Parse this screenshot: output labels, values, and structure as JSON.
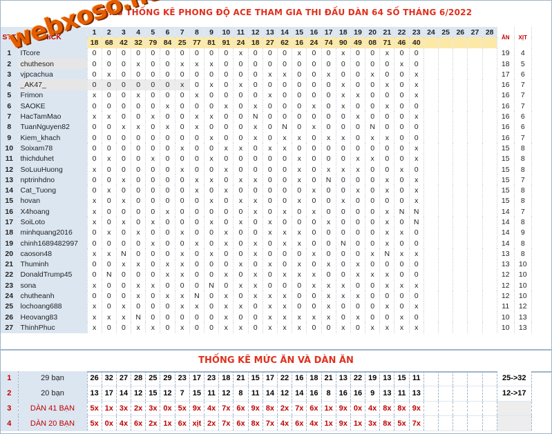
{
  "title": "BẢNG THỐNG KÊ PHONG ĐỘ ACE THAM GIA THI ĐẤU DÀN 64 SỐ THÁNG 6/2022",
  "watermark": "webxoso.net",
  "header": {
    "stt": "STT",
    "nick": "NICK",
    "days": [
      "1",
      "2",
      "3",
      "4",
      "5",
      "6",
      "7",
      "8",
      "9",
      "10",
      "11",
      "12",
      "13",
      "14",
      "15",
      "16",
      "17",
      "18",
      "19",
      "20",
      "21",
      "22",
      "23",
      "24",
      "25",
      "26",
      "27",
      "28"
    ],
    "results": [
      "18",
      "68",
      "42",
      "32",
      "79",
      "84",
      "25",
      "77",
      "81",
      "91",
      "24",
      "18",
      "27",
      "62",
      "16",
      "24",
      "74",
      "90",
      "49",
      "08",
      "71",
      "46",
      "40",
      "",
      "",
      "",
      "",
      ""
    ],
    "an": "ĂN",
    "xit": "XỊT"
  },
  "rows": [
    {
      "stt": "1",
      "nick": "ITcore",
      "marks": [
        "0",
        "0",
        "0",
        "0",
        "0",
        "0",
        "0",
        "0",
        "0",
        "0",
        "x",
        "0",
        "0",
        "0",
        "x",
        "0",
        "0",
        "x",
        "0",
        "0",
        "x",
        "0",
        "0"
      ],
      "an": "19",
      "xit": "4"
    },
    {
      "stt": "2",
      "nick": "chutheson",
      "marks": [
        "0",
        "0",
        "0",
        "x",
        "0",
        "0",
        "x",
        "x",
        "x",
        "0",
        "0",
        "0",
        "0",
        "0",
        "0",
        "0",
        "0",
        "0",
        "0",
        "0",
        "0",
        "x",
        "0"
      ],
      "an": "18",
      "xit": "5"
    },
    {
      "stt": "3",
      "nick": "vjpcachua",
      "marks": [
        "0",
        "x",
        "0",
        "0",
        "0",
        "0",
        "0",
        "0",
        "0",
        "0",
        "0",
        "0",
        "x",
        "x",
        "0",
        "0",
        "x",
        "0",
        "0",
        "x",
        "0",
        "0",
        "x"
      ],
      "an": "17",
      "xit": "6"
    },
    {
      "stt": "4",
      "nick": "_AK47_",
      "marks": [
        "0",
        "0",
        "0",
        "0",
        "0",
        "0",
        "x",
        "0",
        "x",
        "0",
        "x",
        "0",
        "0",
        "0",
        "0",
        "0",
        "0",
        "x",
        "0",
        "0",
        "x",
        "0",
        "x"
      ],
      "an": "16",
      "xit": "7"
    },
    {
      "stt": "5",
      "nick": "Frimon",
      "marks": [
        "x",
        "0",
        "0",
        "x",
        "0",
        "0",
        "0",
        "x",
        "0",
        "0",
        "0",
        "0",
        "x",
        "0",
        "0",
        "0",
        "0",
        "x",
        "x",
        "0",
        "0",
        "0",
        "x"
      ],
      "an": "16",
      "xit": "7"
    },
    {
      "stt": "6",
      "nick": "SAOKE",
      "marks": [
        "0",
        "0",
        "0",
        "0",
        "0",
        "x",
        "0",
        "0",
        "0",
        "x",
        "0",
        "x",
        "0",
        "0",
        "0",
        "x",
        "0",
        "x",
        "0",
        "0",
        "x",
        "0",
        "0"
      ],
      "an": "16",
      "xit": "7"
    },
    {
      "stt": "7",
      "nick": "HacTamMao",
      "marks": [
        "x",
        "x",
        "0",
        "0",
        "x",
        "0",
        "0",
        "x",
        "x",
        "0",
        "0",
        "N",
        "0",
        "0",
        "0",
        "0",
        "0",
        "0",
        "x",
        "0",
        "0",
        "0",
        "x"
      ],
      "an": "16",
      "xit": "6"
    },
    {
      "stt": "8",
      "nick": "TuanNguyen82",
      "marks": [
        "0",
        "0",
        "x",
        "x",
        "0",
        "x",
        "0",
        "x",
        "0",
        "0",
        "0",
        "x",
        "0",
        "N",
        "0",
        "x",
        "0",
        "0",
        "0",
        "N",
        "0",
        "0",
        "0"
      ],
      "an": "16",
      "xit": "6"
    },
    {
      "stt": "9",
      "nick": "Kiem_khach",
      "marks": [
        "0",
        "0",
        "0",
        "0",
        "0",
        "0",
        "0",
        "0",
        "x",
        "0",
        "0",
        "x",
        "0",
        "x",
        "x",
        "0",
        "x",
        "x",
        "0",
        "x",
        "x",
        "0",
        "0"
      ],
      "an": "16",
      "xit": "7"
    },
    {
      "stt": "10",
      "nick": "Soixam78",
      "marks": [
        "0",
        "0",
        "0",
        "0",
        "0",
        "0",
        "x",
        "0",
        "0",
        "x",
        "x",
        "0",
        "x",
        "x",
        "0",
        "0",
        "0",
        "0",
        "0",
        "0",
        "0",
        "0",
        "x"
      ],
      "an": "15",
      "xit": "8"
    },
    {
      "stt": "11",
      "nick": "thichduhet",
      "marks": [
        "0",
        "x",
        "0",
        "0",
        "x",
        "0",
        "0",
        "0",
        "x",
        "0",
        "0",
        "0",
        "0",
        "0",
        "x",
        "0",
        "0",
        "0",
        "x",
        "x",
        "0",
        "0",
        "x"
      ],
      "an": "15",
      "xit": "8"
    },
    {
      "stt": "12",
      "nick": "SoLuuHuong",
      "marks": [
        "x",
        "0",
        "0",
        "0",
        "0",
        "0",
        "x",
        "0",
        "0",
        "x",
        "0",
        "0",
        "0",
        "0",
        "x",
        "0",
        "x",
        "x",
        "x",
        "0",
        "0",
        "x",
        "0"
      ],
      "an": "15",
      "xit": "8"
    },
    {
      "stt": "13",
      "nick": "nptrinhdno",
      "marks": [
        "0",
        "0",
        "x",
        "0",
        "0",
        "0",
        "0",
        "x",
        "x",
        "0",
        "x",
        "x",
        "0",
        "0",
        "x",
        "0",
        "N",
        "0",
        "0",
        "0",
        "x",
        "0",
        "x"
      ],
      "an": "15",
      "xit": "7"
    },
    {
      "stt": "14",
      "nick": "Cat_Tuong",
      "marks": [
        "0",
        "x",
        "0",
        "0",
        "0",
        "0",
        "0",
        "x",
        "0",
        "x",
        "0",
        "0",
        "0",
        "0",
        "0",
        "x",
        "0",
        "0",
        "x",
        "0",
        "x",
        "0",
        "x"
      ],
      "an": "15",
      "xit": "8"
    },
    {
      "stt": "15",
      "nick": "hovan",
      "marks": [
        "x",
        "0",
        "x",
        "0",
        "0",
        "0",
        "0",
        "0",
        "x",
        "0",
        "x",
        "x",
        "0",
        "0",
        "x",
        "0",
        "0",
        "x",
        "0",
        "0",
        "0",
        "0",
        "x"
      ],
      "an": "15",
      "xit": "8"
    },
    {
      "stt": "16",
      "nick": "X4hoang",
      "marks": [
        "x",
        "0",
        "0",
        "0",
        "0",
        "x",
        "0",
        "0",
        "0",
        "0",
        "0",
        "x",
        "0",
        "x",
        "0",
        "x",
        "0",
        "0",
        "0",
        "0",
        "x",
        "N",
        "N"
      ],
      "an": "14",
      "xit": "7"
    },
    {
      "stt": "17",
      "nick": "SoiLoto",
      "marks": [
        "x",
        "0",
        "x",
        "0",
        "x",
        "0",
        "0",
        "0",
        "x",
        "0",
        "x",
        "0",
        "x",
        "0",
        "0",
        "0",
        "x",
        "0",
        "0",
        "0",
        "x",
        "0",
        "N"
      ],
      "an": "14",
      "xit": "8"
    },
    {
      "stt": "18",
      "nick": "minhquang2016",
      "marks": [
        "0",
        "x",
        "0",
        "x",
        "0",
        "0",
        "x",
        "0",
        "0",
        "x",
        "0",
        "0",
        "x",
        "x",
        "x",
        "0",
        "0",
        "0",
        "0",
        "0",
        "x",
        "x",
        "0"
      ],
      "an": "14",
      "xit": "9"
    },
    {
      "stt": "19",
      "nick": "chinh1689482997",
      "marks": [
        "0",
        "0",
        "0",
        "0",
        "x",
        "0",
        "0",
        "x",
        "0",
        "x",
        "0",
        "x",
        "0",
        "x",
        "x",
        "0",
        "0",
        "N",
        "0",
        "0",
        "x",
        "0",
        "0"
      ],
      "an": "14",
      "xit": "8"
    },
    {
      "stt": "20",
      "nick": "caoson48",
      "marks": [
        "x",
        "x",
        "N",
        "0",
        "0",
        "0",
        "x",
        "0",
        "x",
        "0",
        "0",
        "x",
        "0",
        "0",
        "0",
        "x",
        "0",
        "0",
        "0",
        "x",
        "N",
        "x",
        "x"
      ],
      "an": "13",
      "xit": "8"
    },
    {
      "stt": "21",
      "nick": "Thuminh",
      "marks": [
        "0",
        "0",
        "x",
        "x",
        "0",
        "x",
        "x",
        "0",
        "0",
        "0",
        "x",
        "0",
        "x",
        "0",
        "x",
        "0",
        "x",
        "0",
        "x",
        "0",
        "0",
        "0",
        "0"
      ],
      "an": "13",
      "xit": "10"
    },
    {
      "stt": "22",
      "nick": "DonaldTrump45",
      "marks": [
        "0",
        "N",
        "0",
        "0",
        "0",
        "x",
        "x",
        "0",
        "0",
        "x",
        "0",
        "x",
        "0",
        "x",
        "x",
        "x",
        "0",
        "0",
        "x",
        "x",
        "x",
        "0",
        "0"
      ],
      "an": "12",
      "xit": "10"
    },
    {
      "stt": "23",
      "nick": "sona",
      "marks": [
        "x",
        "0",
        "0",
        "x",
        "x",
        "0",
        "0",
        "0",
        "N",
        "0",
        "x",
        "x",
        "0",
        "0",
        "0",
        "x",
        "x",
        "x",
        "0",
        "0",
        "x",
        "x",
        "x"
      ],
      "an": "12",
      "xit": "10"
    },
    {
      "stt": "24",
      "nick": "chutheanh",
      "marks": [
        "0",
        "0",
        "0",
        "x",
        "0",
        "x",
        "x",
        "N",
        "0",
        "x",
        "0",
        "x",
        "x",
        "x",
        "0",
        "0",
        "x",
        "x",
        "x",
        "0",
        "0",
        "0",
        "0"
      ],
      "an": "12",
      "xit": "10"
    },
    {
      "stt": "25",
      "nick": "lochoang688",
      "marks": [
        "x",
        "0",
        "x",
        "0",
        "0",
        "0",
        "x",
        "x",
        "0",
        "x",
        "x",
        "0",
        "x",
        "x",
        "0",
        "0",
        "x",
        "0",
        "0",
        "0",
        "x",
        "0",
        "x"
      ],
      "an": "11",
      "xit": "12"
    },
    {
      "stt": "26",
      "nick": "Heovang83",
      "marks": [
        "x",
        "x",
        "x",
        "N",
        "0",
        "0",
        "0",
        "0",
        "0",
        "x",
        "0",
        "0",
        "x",
        "x",
        "x",
        "x",
        "x",
        "0",
        "x",
        "0",
        "0",
        "x",
        "0"
      ],
      "an": "10",
      "xit": "13"
    },
    {
      "stt": "27",
      "nick": "ThinhPhuc",
      "marks": [
        "x",
        "0",
        "0",
        "x",
        "x",
        "0",
        "x",
        "0",
        "0",
        "x",
        "x",
        "0",
        "x",
        "x",
        "x",
        "0",
        "0",
        "x",
        "0",
        "x",
        "x",
        "x",
        "x"
      ],
      "an": "10",
      "xit": "13"
    }
  ],
  "stats": {
    "section_title": "THỐNG KÊ MỨC ĂN VÀ DÀN ĂN",
    "rows": [
      {
        "idx": "1",
        "label": "29 bạn",
        "cells": [
          "26",
          "32",
          "27",
          "28",
          "25",
          "29",
          "23",
          "17",
          "23",
          "18",
          "21",
          "15",
          "17",
          "22",
          "16",
          "18",
          "21",
          "13",
          "22",
          "19",
          "13",
          "15",
          "11"
        ],
        "end": "25->32",
        "red": false
      },
      {
        "idx": "2",
        "label": "20 bạn",
        "cells": [
          "13",
          "17",
          "14",
          "12",
          "15",
          "12",
          "7",
          "15",
          "11",
          "12",
          "8",
          "11",
          "14",
          "12",
          "14",
          "16",
          "8",
          "16",
          "16",
          "9",
          "13",
          "11",
          "13"
        ],
        "end": "12->17",
        "red": false
      },
      {
        "idx": "3",
        "label": "DÀN 41 BẠN",
        "cells": [
          "5x",
          "1x",
          "3x",
          "2x",
          "3x",
          "0x",
          "5x",
          "9x",
          "4x",
          "7x",
          "6x",
          "9x",
          "8x",
          "2x",
          "7x",
          "6x",
          "1x",
          "9x",
          "0x",
          "4x",
          "8x",
          "8x",
          "9x"
        ],
        "end": "",
        "red": true
      },
      {
        "idx": "4",
        "label": "DÀN 20 BẠN",
        "cells": [
          "5x",
          "0x",
          "4x",
          "6x",
          "2x",
          "1x",
          "6x",
          "xịt",
          "2x",
          "7x",
          "6x",
          "8x",
          "7x",
          "4x",
          "6x",
          "4x",
          "1x",
          "9x",
          "1x",
          "3x",
          "8x",
          "5x",
          "7x"
        ],
        "end": "",
        "red": true
      }
    ]
  }
}
